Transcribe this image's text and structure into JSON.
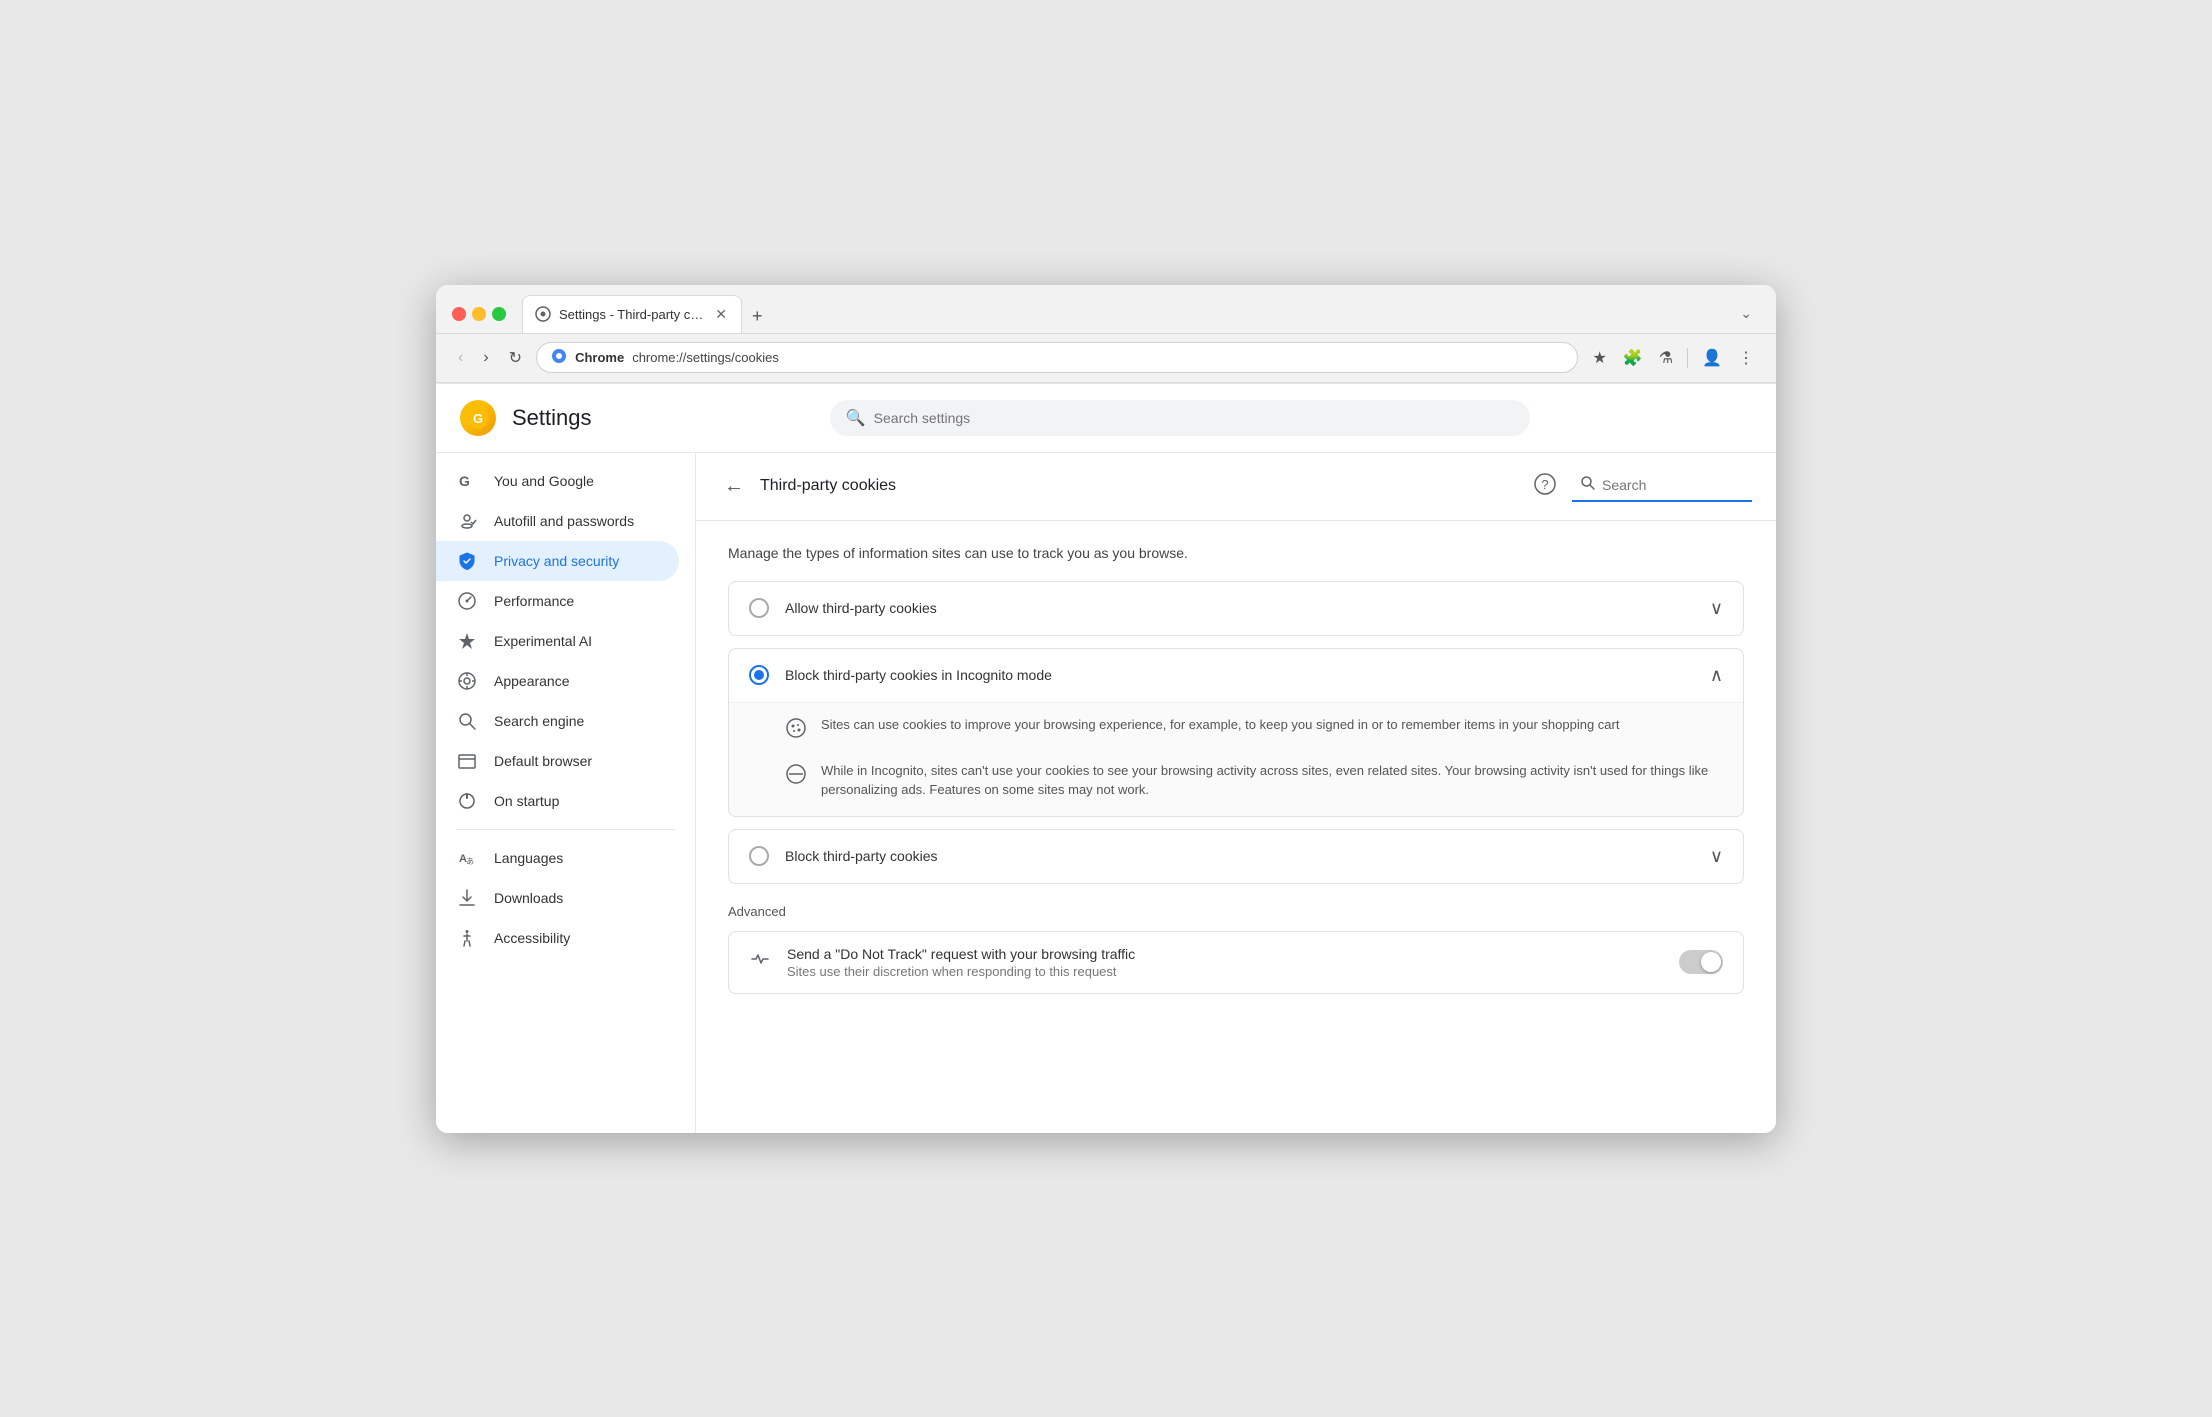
{
  "browser": {
    "tab_title": "Settings - Third-party cookie",
    "url": "chrome://settings/cookies",
    "address_label": "Chrome"
  },
  "settings": {
    "title": "Settings",
    "search_placeholder": "Search settings",
    "logo_char": "G"
  },
  "sidebar": {
    "items": [
      {
        "id": "you-and-google",
        "label": "You and Google",
        "icon": "G",
        "active": false
      },
      {
        "id": "autofill",
        "label": "Autofill and passwords",
        "icon": "🔑",
        "active": false
      },
      {
        "id": "privacy",
        "label": "Privacy and security",
        "icon": "🛡",
        "active": true
      },
      {
        "id": "performance",
        "label": "Performance",
        "icon": "⏱",
        "active": false
      },
      {
        "id": "experimental-ai",
        "label": "Experimental AI",
        "icon": "✦",
        "active": false
      },
      {
        "id": "appearance",
        "label": "Appearance",
        "icon": "🎨",
        "active": false
      },
      {
        "id": "search-engine",
        "label": "Search engine",
        "icon": "🔍",
        "active": false
      },
      {
        "id": "default-browser",
        "label": "Default browser",
        "icon": "☐",
        "active": false
      },
      {
        "id": "on-startup",
        "label": "On startup",
        "icon": "⏻",
        "active": false
      },
      {
        "id": "languages",
        "label": "Languages",
        "icon": "A",
        "active": false
      },
      {
        "id": "downloads",
        "label": "Downloads",
        "icon": "⬇",
        "active": false
      },
      {
        "id": "accessibility",
        "label": "Accessibility",
        "icon": "♿",
        "active": false
      }
    ]
  },
  "content": {
    "page_title": "Third-party cookies",
    "search_placeholder": "Search",
    "description": "Manage the types of information sites can use to track you as you browse.",
    "options": [
      {
        "id": "allow",
        "label": "Allow third-party cookies",
        "selected": false,
        "expanded": false,
        "details": []
      },
      {
        "id": "block-incognito",
        "label": "Block third-party cookies in Incognito mode",
        "selected": true,
        "expanded": true,
        "details": [
          {
            "icon": "🍪",
            "text": "Sites can use cookies to improve your browsing experience, for example, to keep you signed in or to remember items in your shopping cart"
          },
          {
            "icon": "⊘",
            "text": "While in Incognito, sites can't use your cookies to see your browsing activity across sites, even related sites. Your browsing activity isn't used for things like personalizing ads. Features on some sites may not work."
          }
        ]
      },
      {
        "id": "block-all",
        "label": "Block third-party cookies",
        "selected": false,
        "expanded": false,
        "details": []
      }
    ],
    "advanced_label": "Advanced",
    "advanced_items": [
      {
        "id": "do-not-track",
        "icon": "↪",
        "title": "Send a \"Do Not Track\" request with your browsing traffic",
        "subtitle": "Sites use their discretion when responding to this request",
        "toggle": false
      }
    ]
  }
}
